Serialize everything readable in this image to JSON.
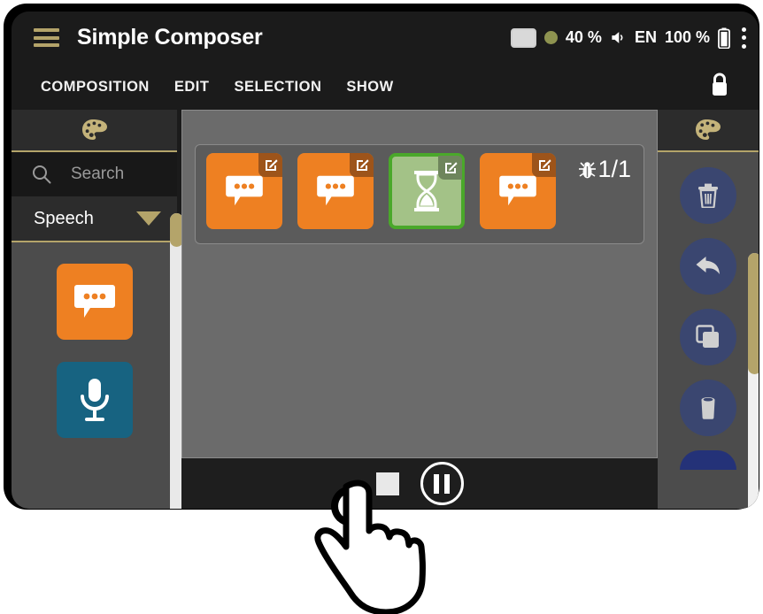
{
  "app": {
    "title": "Simple Composer",
    "menu_icon": "hamburger-icon"
  },
  "statusbar": {
    "screen_icon": "screen-icon",
    "indicator_icon": "status-dot-icon",
    "brightness": "40 %",
    "speaker_icon": "speaker-icon",
    "language": "EN",
    "volume": "100 %",
    "battery_icon": "battery-icon",
    "overflow_icon": "kebab-menu-icon"
  },
  "menubar": {
    "items": [
      {
        "label": "COMPOSITION"
      },
      {
        "label": "EDIT"
      },
      {
        "label": "SELECTION"
      },
      {
        "label": "SHOW"
      }
    ],
    "lock_icon": "lock-closed-icon"
  },
  "left_panel": {
    "palette_icon": "palette-icon",
    "search": {
      "icon": "search-icon",
      "placeholder": "Search",
      "value": ""
    },
    "group": {
      "label": "Speech",
      "caret_icon": "chevron-down-icon",
      "expanded": true
    },
    "tiles": [
      {
        "name": "speech-bubble-tile",
        "icon": "speech-bubble-icon",
        "color": "#ee8022"
      },
      {
        "name": "microphone-tile",
        "icon": "microphone-icon",
        "color": "#176381"
      }
    ],
    "scrollbar": {
      "thumb_color": "#b4a46a",
      "track_color": "#e9e9e9",
      "position_pct": 0
    }
  },
  "canvas": {
    "sequence_blocks": [
      {
        "name": "speech-block-1",
        "icon": "speech-bubble-icon",
        "color": "#ee8022",
        "selected": false,
        "edit_badge": "edit-pencil-icon"
      },
      {
        "name": "speech-block-2",
        "icon": "speech-bubble-icon",
        "color": "#ee8022",
        "selected": false,
        "edit_badge": "edit-pencil-icon"
      },
      {
        "name": "wait-block",
        "icon": "hourglass-icon",
        "color": "#a3c287",
        "selected": true,
        "edit_badge": "edit-pencil-icon"
      },
      {
        "name": "speech-block-3",
        "icon": "speech-bubble-icon",
        "color": "#ee8022",
        "selected": false,
        "edit_badge": "edit-pencil-icon"
      }
    ],
    "debug": {
      "icon": "bug-icon",
      "counter": "1/1"
    }
  },
  "transport": {
    "stop_label": "stop-icon",
    "pause_label": "pause-icon"
  },
  "right_panel": {
    "palette_icon": "palette-icon",
    "tools": [
      {
        "name": "delete-all-button",
        "icon": "trash-can-icon"
      },
      {
        "name": "undo-button",
        "icon": "undo-arrow-icon"
      },
      {
        "name": "duplicate-button",
        "icon": "copy-icon"
      },
      {
        "name": "delete-button",
        "icon": "bin-icon"
      },
      {
        "name": "more-tools-button",
        "icon": "partial-button-icon"
      }
    ],
    "scrollbar": {
      "thumb_color": "#b4a46a",
      "track_color": "#f0f0f0",
      "position_pct": 0
    }
  },
  "cursor": {
    "type": "pointing-hand-cursor",
    "target": "stop-button"
  },
  "colors": {
    "accent_gold": "#b4a46a",
    "block_orange": "#ee8022",
    "block_teal": "#176381",
    "block_green": "#a3c287",
    "selection_green": "#4aa82a",
    "tool_blue": "#3a4670",
    "panel_gray": "#4c4c4c",
    "canvas_gray": "#6b6b6b",
    "chrome_dark": "#1b1b1b"
  }
}
